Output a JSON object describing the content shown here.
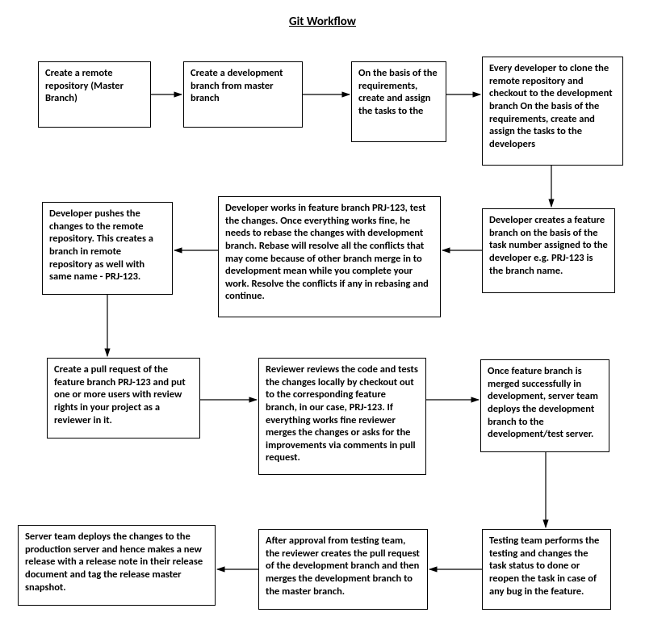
{
  "title": "Git Workflow",
  "boxes": {
    "b1": "Create a remote repository (Master Branch)",
    "b2": "Create a development branch from master branch",
    "b3": "On the basis of the requirements, create and assign the tasks to the",
    "b4": "Every developer to clone the remote repository and checkout to the development branch On the basis of the requirements, create and assign the tasks to the developers",
    "b5": "Developer creates a feature branch on the basis of the task number assigned to the developer e.g. PRJ-123 is the branch name.",
    "b6": "Developer works in feature branch PRJ-123, test the changes. Once everything works fine, he needs to rebase the changes with development branch. Rebase will resolve all the conflicts that may come because of other branch merge in to development mean while you complete your work. Resolve the conflicts if any in rebasing and continue.",
    "b7": "Developer pushes the changes to the remote repository. This creates a branch in remote repository as well with same name - PRJ-123.",
    "b8": "Create a pull request of the feature branch PRJ-123 and put one or more users with review rights in your project as a reviewer in it.",
    "b9": "Reviewer reviews the code and tests the changes locally by checkout out to the corresponding feature branch, in our case, PRJ-123. If everything works fine reviewer merges the changes or asks for the improvements via comments in pull request.",
    "b10": "Once feature branch is merged successfully in development, server team deploys the development branch to the development/test server.",
    "b11": "Testing team performs the testing and changes the task status to done or reopen the task in case of any bug in the feature.",
    "b12": "After approval from testing team, the reviewer creates the pull request of the development branch and then merges the development branch to the master branch.",
    "b13": "Server team deploys the changes to the production server and hence makes a new release with a release note in their release document and tag the release master snapshot."
  }
}
